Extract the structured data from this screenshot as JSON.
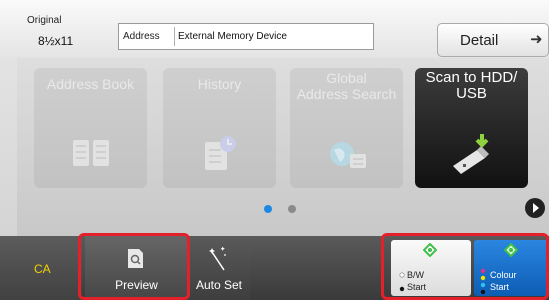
{
  "top": {
    "original_label": "Original",
    "original_size": "8½x11",
    "address_label": "Address",
    "address_value": "External Memory Device",
    "detail_label": "Detail"
  },
  "tiles": [
    {
      "label": "Address Book",
      "icon": "address-book-icon",
      "enabled": false
    },
    {
      "label": "History",
      "icon": "history-icon",
      "enabled": false
    },
    {
      "label": "Global\nAddress Search",
      "icon": "global-address-search-icon",
      "enabled": false
    },
    {
      "label": "Scan to HDD/\nUSB",
      "icon": "usb-drive-icon",
      "enabled": true
    }
  ],
  "pager": {
    "current_page": 1,
    "total_pages": 2
  },
  "bottom": {
    "ca_label": "CA",
    "preview_label": "Preview",
    "auto_set_label": "Auto Set",
    "bw_label_1": "B/W",
    "bw_label_2": "Start",
    "colour_label_1": "Colour",
    "colour_label_2": "Start"
  },
  "colors": {
    "ca_text": "#f2d200",
    "highlight": "#e4202a",
    "colour_start": "#1672cc",
    "pager_active": "#1e88e5",
    "start_diamond": "#3fbf4a"
  }
}
